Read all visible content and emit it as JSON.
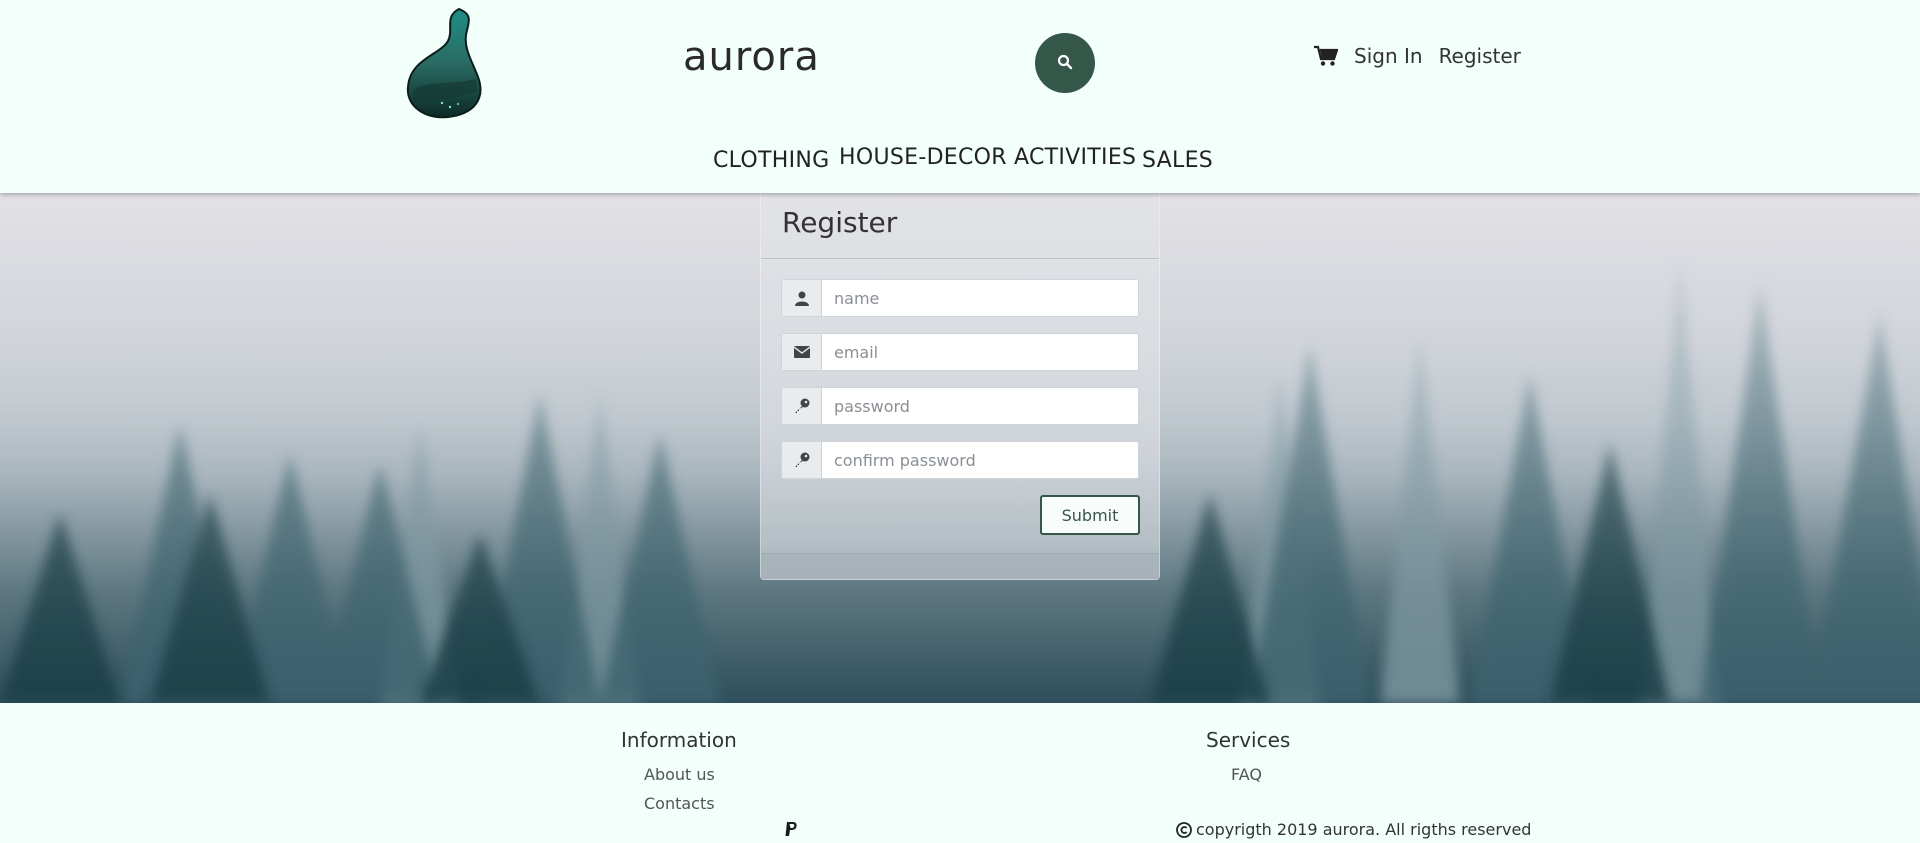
{
  "header": {
    "brand": "aurora",
    "links": {
      "sign_in": "Sign In",
      "register": "Register"
    },
    "icons": {
      "cart": "cart-icon",
      "search": "search-icon"
    }
  },
  "nav": {
    "items": [
      {
        "label": "CLOTHING"
      },
      {
        "label": "HOUSE-DECOR"
      },
      {
        "label": "ACTIVITIES"
      },
      {
        "label": "SALES"
      }
    ]
  },
  "register_form": {
    "title": "Register",
    "fields": [
      {
        "placeholder": "name",
        "value": "",
        "icon": "user-icon"
      },
      {
        "placeholder": "email",
        "value": "",
        "icon": "envelope-icon"
      },
      {
        "placeholder": "password",
        "value": "",
        "icon": "key-icon"
      },
      {
        "placeholder": "confirm password",
        "value": "",
        "icon": "key-icon"
      }
    ],
    "submit_label": "Submit"
  },
  "footer": {
    "information": {
      "heading": "Information",
      "links": [
        "About us",
        "Contacts"
      ]
    },
    "services": {
      "heading": "Services",
      "links": [
        "FAQ"
      ]
    },
    "copyright": "copyrigth 2019 aurora. All rigths reserved",
    "icons": {
      "payment": "paypal-icon",
      "copyright": "copyright-icon"
    }
  },
  "colors": {
    "accent": "#35574a",
    "header_bg": "#f2fffa",
    "footer_bg": "#f2fffa"
  }
}
